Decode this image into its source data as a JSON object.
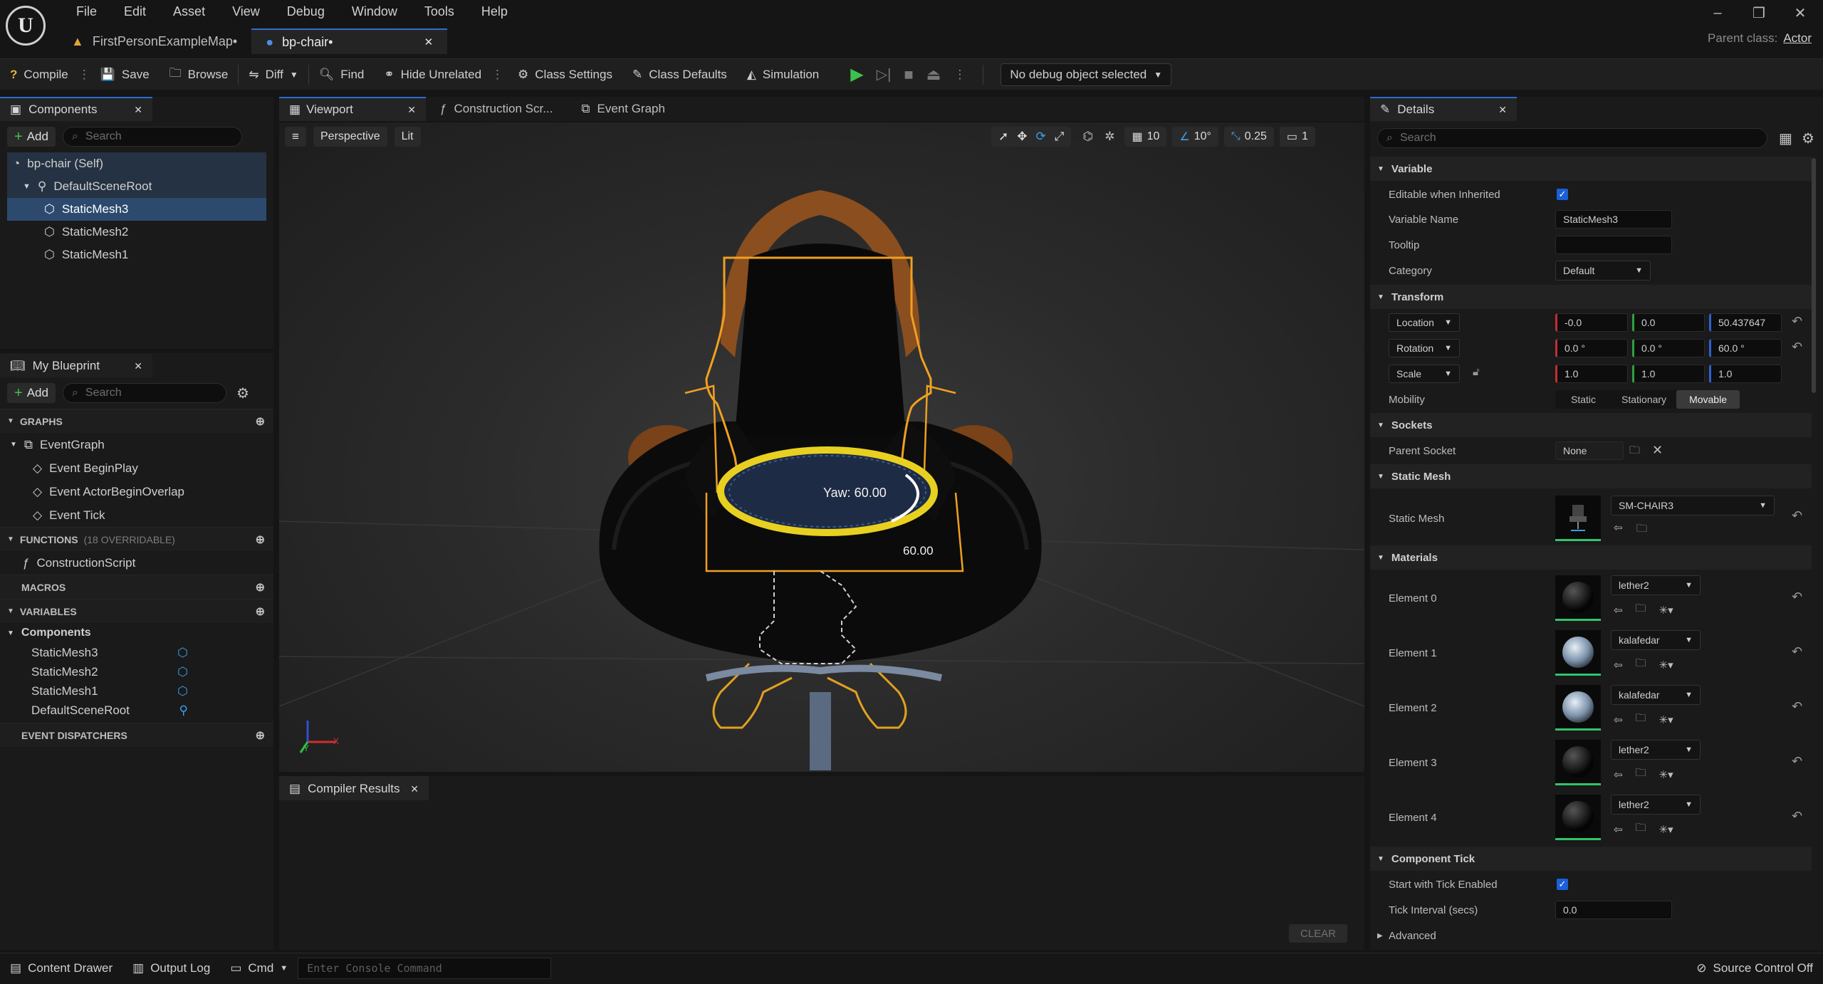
{
  "menu": [
    "File",
    "Edit",
    "Asset",
    "View",
    "Debug",
    "Window",
    "Tools",
    "Help"
  ],
  "tabs": [
    {
      "label": "FirstPersonExampleMap•"
    },
    {
      "label": "bp-chair•"
    }
  ],
  "parent_class": {
    "label": "Parent class:",
    "value": "Actor"
  },
  "toolbar": {
    "compile": "Compile",
    "save": "Save",
    "browse": "Browse",
    "diff": "Diff",
    "find": "Find",
    "hide_unrelated": "Hide Unrelated",
    "class_settings": "Class Settings",
    "class_defaults": "Class Defaults",
    "simulation": "Simulation",
    "debug_select": "No debug object selected"
  },
  "components": {
    "title": "Components",
    "add": "Add",
    "search_placeholder": "Search",
    "items": [
      "bp-chair (Self)",
      "DefaultSceneRoot",
      "StaticMesh3",
      "StaticMesh2",
      "StaticMesh1"
    ]
  },
  "my_blueprint": {
    "title": "My Blueprint",
    "add": "Add",
    "search_placeholder": "Search",
    "graphs_header": "GRAPHS",
    "event_graph": "EventGraph",
    "events": [
      "Event BeginPlay",
      "Event ActorBeginOverlap",
      "Event Tick"
    ],
    "functions_header": "FUNCTIONS",
    "functions_count": "(18 OVERRIDABLE)",
    "construction_script": "ConstructionScript",
    "macros_header": "MACROS",
    "variables_header": "VARIABLES",
    "components_group": "Components",
    "variables": [
      "StaticMesh3",
      "StaticMesh2",
      "StaticMesh1",
      "DefaultSceneRoot"
    ],
    "event_dispatchers_header": "EVENT DISPATCHERS"
  },
  "viewport": {
    "tabs": [
      "Viewport",
      "Construction Scr...",
      "Event Graph"
    ],
    "perspective": "Perspective",
    "lit": "Lit",
    "grid": "10",
    "angle": "10°",
    "scale": "0.25",
    "camera": "1",
    "yaw_label": "Yaw: 60.00",
    "angle_label": "60.00",
    "axis_x": "X",
    "axis_y": "Y"
  },
  "compiler": {
    "title": "Compiler Results",
    "clear": "CLEAR"
  },
  "details": {
    "title": "Details",
    "search_placeholder": "Search",
    "variable_section": "Variable",
    "editable_label": "Editable when Inherited",
    "var_name_label": "Variable Name",
    "var_name_value": "StaticMesh3",
    "tooltip_label": "Tooltip",
    "tooltip_value": "",
    "category_label": "Category",
    "category_value": "Default",
    "transform_section": "Transform",
    "location_label": "Location",
    "location": [
      "-0.0",
      "0.0",
      "50.437647"
    ],
    "rotation_label": "Rotation",
    "rotation": [
      "0.0 °",
      "0.0 °",
      "60.0 °"
    ],
    "scale_label": "Scale",
    "scale": [
      "1.0",
      "1.0",
      "1.0"
    ],
    "mobility_label": "Mobility",
    "mobility_options": [
      "Static",
      "Stationary",
      "Movable"
    ],
    "mobility_selected": "Movable",
    "sockets_section": "Sockets",
    "parent_socket_label": "Parent Socket",
    "parent_socket_value": "None",
    "static_mesh_section": "Static Mesh",
    "static_mesh_label": "Static Mesh",
    "static_mesh_value": "SM-CHAIR3",
    "materials_section": "Materials",
    "materials": [
      {
        "label": "Element 0",
        "value": "lether2"
      },
      {
        "label": "Element 1",
        "value": "kalafedar"
      },
      {
        "label": "Element 2",
        "value": "kalafedar"
      },
      {
        "label": "Element 3",
        "value": "lether2"
      },
      {
        "label": "Element 4",
        "value": "lether2"
      }
    ],
    "component_tick_section": "Component Tick",
    "tick_enabled_label": "Start with Tick Enabled",
    "tick_interval_label": "Tick Interval (secs)",
    "tick_interval_value": "0.0",
    "advanced": "Advanced"
  },
  "statusbar": {
    "content_drawer": "Content Drawer",
    "output_log": "Output Log",
    "cmd": "Cmd",
    "console_placeholder": "Enter Console Command",
    "source_control": "Source Control Off"
  },
  "colors": {
    "accent": "#2f6bd0",
    "selection": "#2d4a6e",
    "outline": "#f0a020",
    "green": "#31c46a"
  }
}
